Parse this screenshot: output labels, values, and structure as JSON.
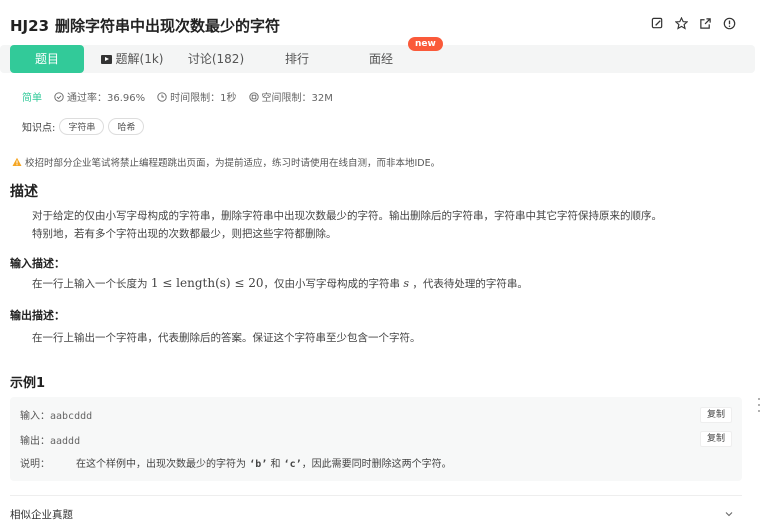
{
  "problem": {
    "code": "HJ23",
    "title": "删除字符串中出现次数最少的字符"
  },
  "header_icons": [
    "edit-icon",
    "star-icon",
    "share-icon",
    "info-icon"
  ],
  "tabs": [
    {
      "label": "题目",
      "active": true
    },
    {
      "label": "题解(1k)"
    },
    {
      "label": "讨论(182)"
    },
    {
      "label": "排行"
    },
    {
      "label": "面经"
    }
  ],
  "new_badge": "new",
  "meta": {
    "difficulty": "简单",
    "pass_rate": "通过率：36.96%",
    "time_limit": "时间限制：1秒",
    "memory_limit": "空间限制：32M"
  },
  "knowledge": {
    "label": "知识点:",
    "tags": [
      "字符串",
      "哈希"
    ]
  },
  "notice": "校招时部分企业笔试将禁止编程题跳出页面，为提前适应，练习时请使用在线自测，而非本地IDE。",
  "description": {
    "heading": "描述",
    "line1": "对于给定的仅由小写字母构成的字符串，删除字符串中出现次数最少的字符。输出删除后的字符串，字符串中其它字符保持原来的顺序。",
    "line2": "特别地，若有多个字符出现的次数都最少，则把这些字符都删除。"
  },
  "input_desc": {
    "heading": "输入描述：",
    "prefix": "在一行上输入一个长度为",
    "math": "1 ≤ length(s) ≤ 20",
    "middle": "，仅由小写字母构成的字符串",
    "var": "s",
    "suffix": "，代表待处理的字符串。"
  },
  "output_desc": {
    "heading": "输出描述：",
    "text": "在一行上输出一个字符串，代表删除后的答案。保证这个字符串至少包含一个字符。"
  },
  "example": {
    "heading": "示例1",
    "input_label": "输入：",
    "input_value": "aabcddd",
    "output_label": "输出：",
    "output_value": "aaddd",
    "copy_label": "复制",
    "note_label": "说明：",
    "note_part1": "在这个样例中，出现次数最少的字符为",
    "note_q1": "‘b’",
    "note_and": "和",
    "note_q2": "‘c’",
    "note_part2": "，因此需要同时删除这两个字符。"
  },
  "similar": {
    "label": "相似企业真题"
  },
  "colors": {
    "accent": "#32ca99",
    "badge": "#fa5a3a",
    "warning": "#f5a623"
  }
}
